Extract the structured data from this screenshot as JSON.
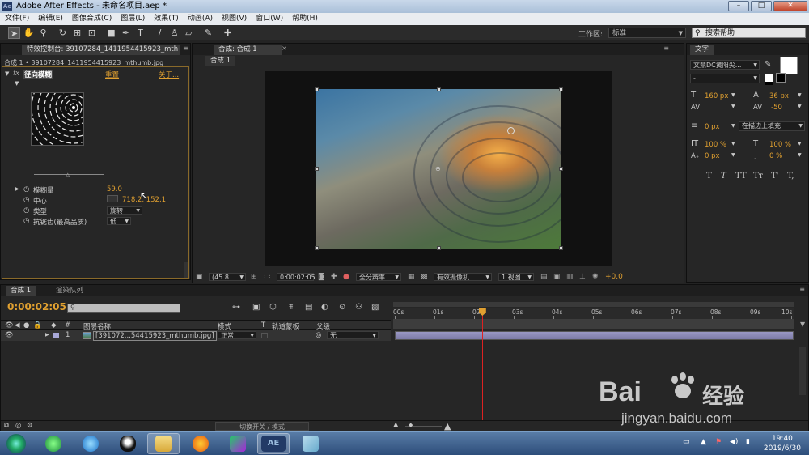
{
  "window": {
    "title": "Adobe After Effects - 未命名项目.aep *"
  },
  "menu": [
    "文件(F)",
    "编辑(E)",
    "图像合成(C)",
    "图层(L)",
    "效果(T)",
    "动画(A)",
    "视图(V)",
    "窗口(W)",
    "帮助(H)"
  ],
  "toolbar": {
    "workspace_label": "工作区:",
    "workspace_value": "标准",
    "search_placeholder": "搜索帮助"
  },
  "effects_panel": {
    "tab_title": "特效控制台: 39107284_1411954415923_mth",
    "comp_path": "合成 1 • 39107284_1411954415923_mthumb.jpg",
    "effect_name": "径向模糊",
    "reset_label": "重置",
    "about_label": "关于...",
    "params": [
      {
        "label": "模糊量",
        "value": "59.0"
      },
      {
        "label": "中心",
        "value": "718.2, 152.1"
      },
      {
        "label": "类型",
        "value": "旋转"
      },
      {
        "label": "抗锯齿(最高品质)",
        "value": "低"
      }
    ]
  },
  "comp_panel": {
    "tab_title": "合成: 合成 1",
    "sub_tab": "合成 1",
    "footer": {
      "zoom": "(45.8 ...",
      "timecode": "0:00:02:05",
      "resolution": "全分辨率",
      "camera": "有效摄像机",
      "views": "1 视图",
      "exposure": "+0.0"
    }
  },
  "char_panel": {
    "tab_title": "文字",
    "font_family": "文鼎DC黄阳尖...",
    "font_style": "-",
    "font_size": "160 px",
    "leading": "36 px",
    "tracking": "-50",
    "stroke_width": "0 px",
    "stroke_mode": "在描边上填充",
    "vscale": "100 %",
    "hscale": "100 %",
    "baseline": "0 px",
    "tsume": "0 %",
    "style_buttons": [
      "T",
      "T",
      "TT",
      "Tт",
      "T'",
      "T,"
    ]
  },
  "timeline": {
    "tab_comp": "合成 1",
    "tab_render": "渲染队列",
    "current_time": "0:00:02:05",
    "col_source": "图层名称",
    "col_mode": "模式",
    "col_t": "T",
    "col_trkmat": "轨道蒙板",
    "col_parent": "父级",
    "ruler": [
      "00s",
      "01s",
      "02s",
      "03s",
      "04s",
      "05s",
      "06s",
      "07s",
      "08s",
      "09s",
      "10s"
    ],
    "layer": {
      "index": "1",
      "name": "[391072...54415923_mthumb.jpg]",
      "mode": "正常",
      "parent": "无"
    },
    "footer_toggle": "切换开关 / 模式",
    "playhead_seconds": 2.2
  },
  "taskbar": {
    "time": "19:40",
    "date": "2019/6/30",
    "ae_label": "AE"
  },
  "watermark": {
    "brand": "Bai",
    "brand2": "经验",
    "url": "jingyan.baidu.com"
  }
}
